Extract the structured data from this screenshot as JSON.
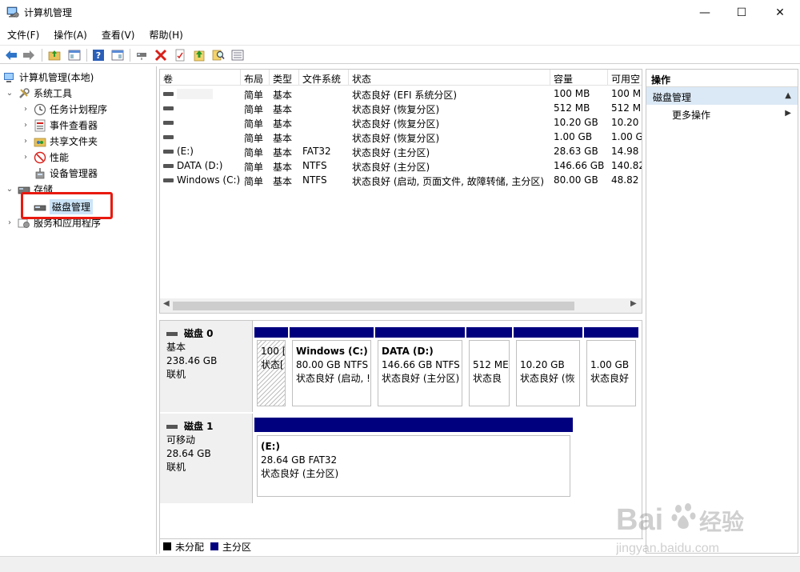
{
  "window": {
    "title": "计算机管理",
    "controls": {
      "minimize": "—",
      "maximize": "☐",
      "close": "✕"
    }
  },
  "menu": [
    "文件(F)",
    "操作(A)",
    "查看(V)",
    "帮助(H)"
  ],
  "tree": {
    "root": "计算机管理(本地)",
    "system_tools": "系统工具",
    "task_scheduler": "任务计划程序",
    "event_viewer": "事件查看器",
    "shared_folders": "共享文件夹",
    "performance": "性能",
    "device_manager": "设备管理器",
    "storage": "存储",
    "disk_management": "磁盘管理",
    "services_apps": "服务和应用程序"
  },
  "volume_list": {
    "columns": [
      "卷",
      "布局",
      "类型",
      "文件系统",
      "状态",
      "容量",
      "可用空"
    ],
    "rows": [
      {
        "volume": "",
        "layout": "简单",
        "type": "基本",
        "fs": "",
        "status": "状态良好 (EFI 系统分区)",
        "capacity": "100 MB",
        "free": "100 M"
      },
      {
        "volume": "",
        "layout": "简单",
        "type": "基本",
        "fs": "",
        "status": "状态良好 (恢复分区)",
        "capacity": "512 MB",
        "free": "512 M"
      },
      {
        "volume": "",
        "layout": "简单",
        "type": "基本",
        "fs": "",
        "status": "状态良好 (恢复分区)",
        "capacity": "10.20 GB",
        "free": "10.20"
      },
      {
        "volume": "",
        "layout": "简单",
        "type": "基本",
        "fs": "",
        "status": "状态良好 (恢复分区)",
        "capacity": "1.00 GB",
        "free": "1.00 G"
      },
      {
        "volume": "(E:)",
        "layout": "简单",
        "type": "基本",
        "fs": "FAT32",
        "status": "状态良好 (主分区)",
        "capacity": "28.63 GB",
        "free": "14.98"
      },
      {
        "volume": "DATA (D:)",
        "layout": "简单",
        "type": "基本",
        "fs": "NTFS",
        "status": "状态良好 (主分区)",
        "capacity": "146.66 GB",
        "free": "140.82"
      },
      {
        "volume": "Windows (C:)",
        "layout": "简单",
        "type": "基本",
        "fs": "NTFS",
        "status": "状态良好 (启动, 页面文件, 故障转储, 主分区)",
        "capacity": "80.00 GB",
        "free": "48.82"
      }
    ]
  },
  "disks": [
    {
      "name": "磁盘 0",
      "kind": "基本",
      "size": "238.46 GB",
      "state": "联机",
      "partitions": [
        {
          "title": "",
          "line1": "100 [",
          "line2": "状态["
        },
        {
          "title": "Windows  (C:)",
          "line1": "80.00 GB NTFS",
          "line2": "状态良好 (启动, !"
        },
        {
          "title": "DATA  (D:)",
          "line1": "146.66 GB NTFS",
          "line2": "状态良好 (主分区)"
        },
        {
          "title": "",
          "line1": "512 ME",
          "line2": "状态良"
        },
        {
          "title": "",
          "line1": "10.20 GB",
          "line2": "状态良好 (恢"
        },
        {
          "title": "",
          "line1": "1.00 GB",
          "line2": "状态良好"
        }
      ]
    },
    {
      "name": "磁盘 1",
      "kind": "可移动",
      "size": "28.64 GB",
      "state": "联机",
      "partitions": [
        {
          "title": "(E:)",
          "line1": "28.64 GB FAT32",
          "line2": "状态良好 (主分区)"
        }
      ]
    }
  ],
  "legend": {
    "unallocated": "未分配",
    "primary": "主分区"
  },
  "actions": {
    "header": "操作",
    "section": "磁盘管理",
    "more": "更多操作"
  },
  "watermark": {
    "brand": "Bai",
    "brand2": "du",
    "suffix": "经验",
    "url": "jingyan.baidu.com"
  },
  "colors": {
    "partition_bar": "#00007f",
    "selection": "#cce4f7",
    "highlight_box": "#e8190f"
  }
}
